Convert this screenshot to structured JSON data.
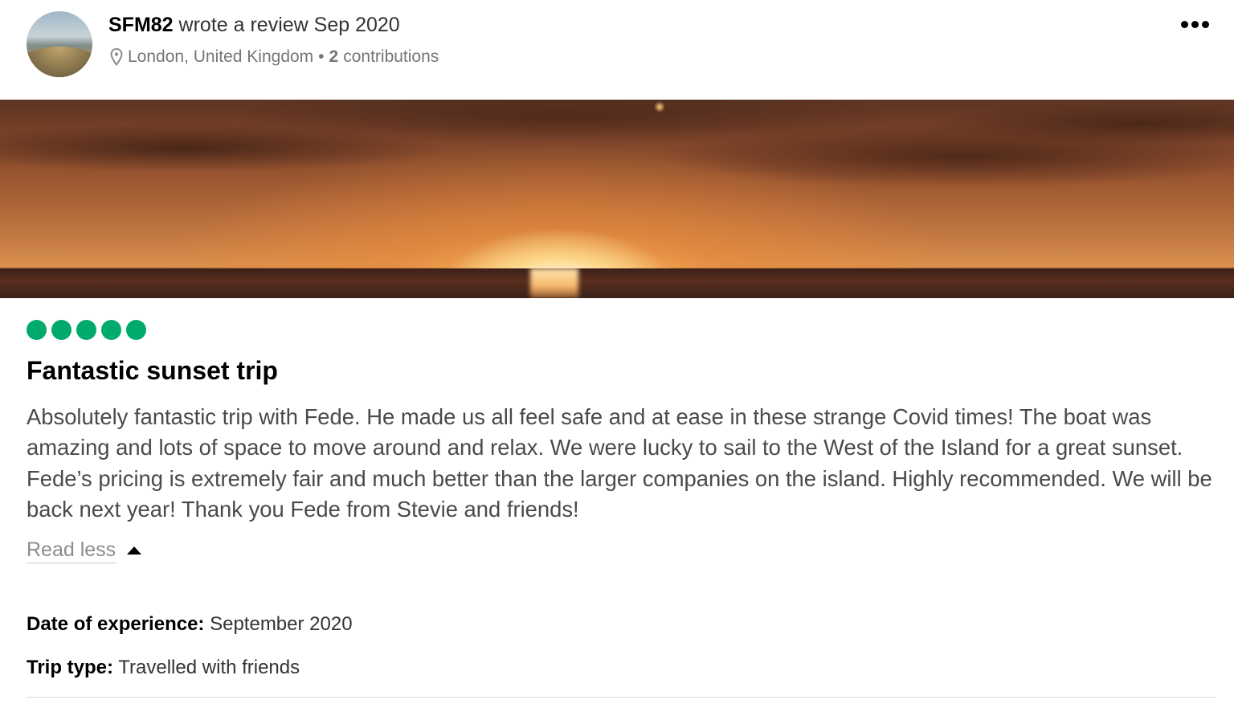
{
  "author": {
    "name": "SFM82",
    "action": "wrote a review Sep 2020",
    "location": "London, United Kingdom",
    "contributions_count": "2",
    "contributions_label": "contributions"
  },
  "menu": {
    "icon": "more-horizontal-icon"
  },
  "photo": {
    "subject": "sunset over sea"
  },
  "rating": {
    "value": 5,
    "max": 5,
    "color": "#00aa6c"
  },
  "review": {
    "title": "Fantastic sunset trip",
    "body": "Absolutely fantastic trip with Fede. He made us all feel safe and at ease in these strange Covid times! The boat was amazing and lots of space to move around and relax. We were lucky to sail to the West of the Island for a great sunset. Fede’s pricing is extremely fair and much better than the larger companies on the island. Highly recommended. We will be back next year! Thank you Fede from Stevie and friends!",
    "read_less_label": "Read less"
  },
  "details": {
    "date_key": "Date of experience:",
    "date_value": "September 2020",
    "trip_key": "Trip type:",
    "trip_value": "Travelled with friends"
  }
}
